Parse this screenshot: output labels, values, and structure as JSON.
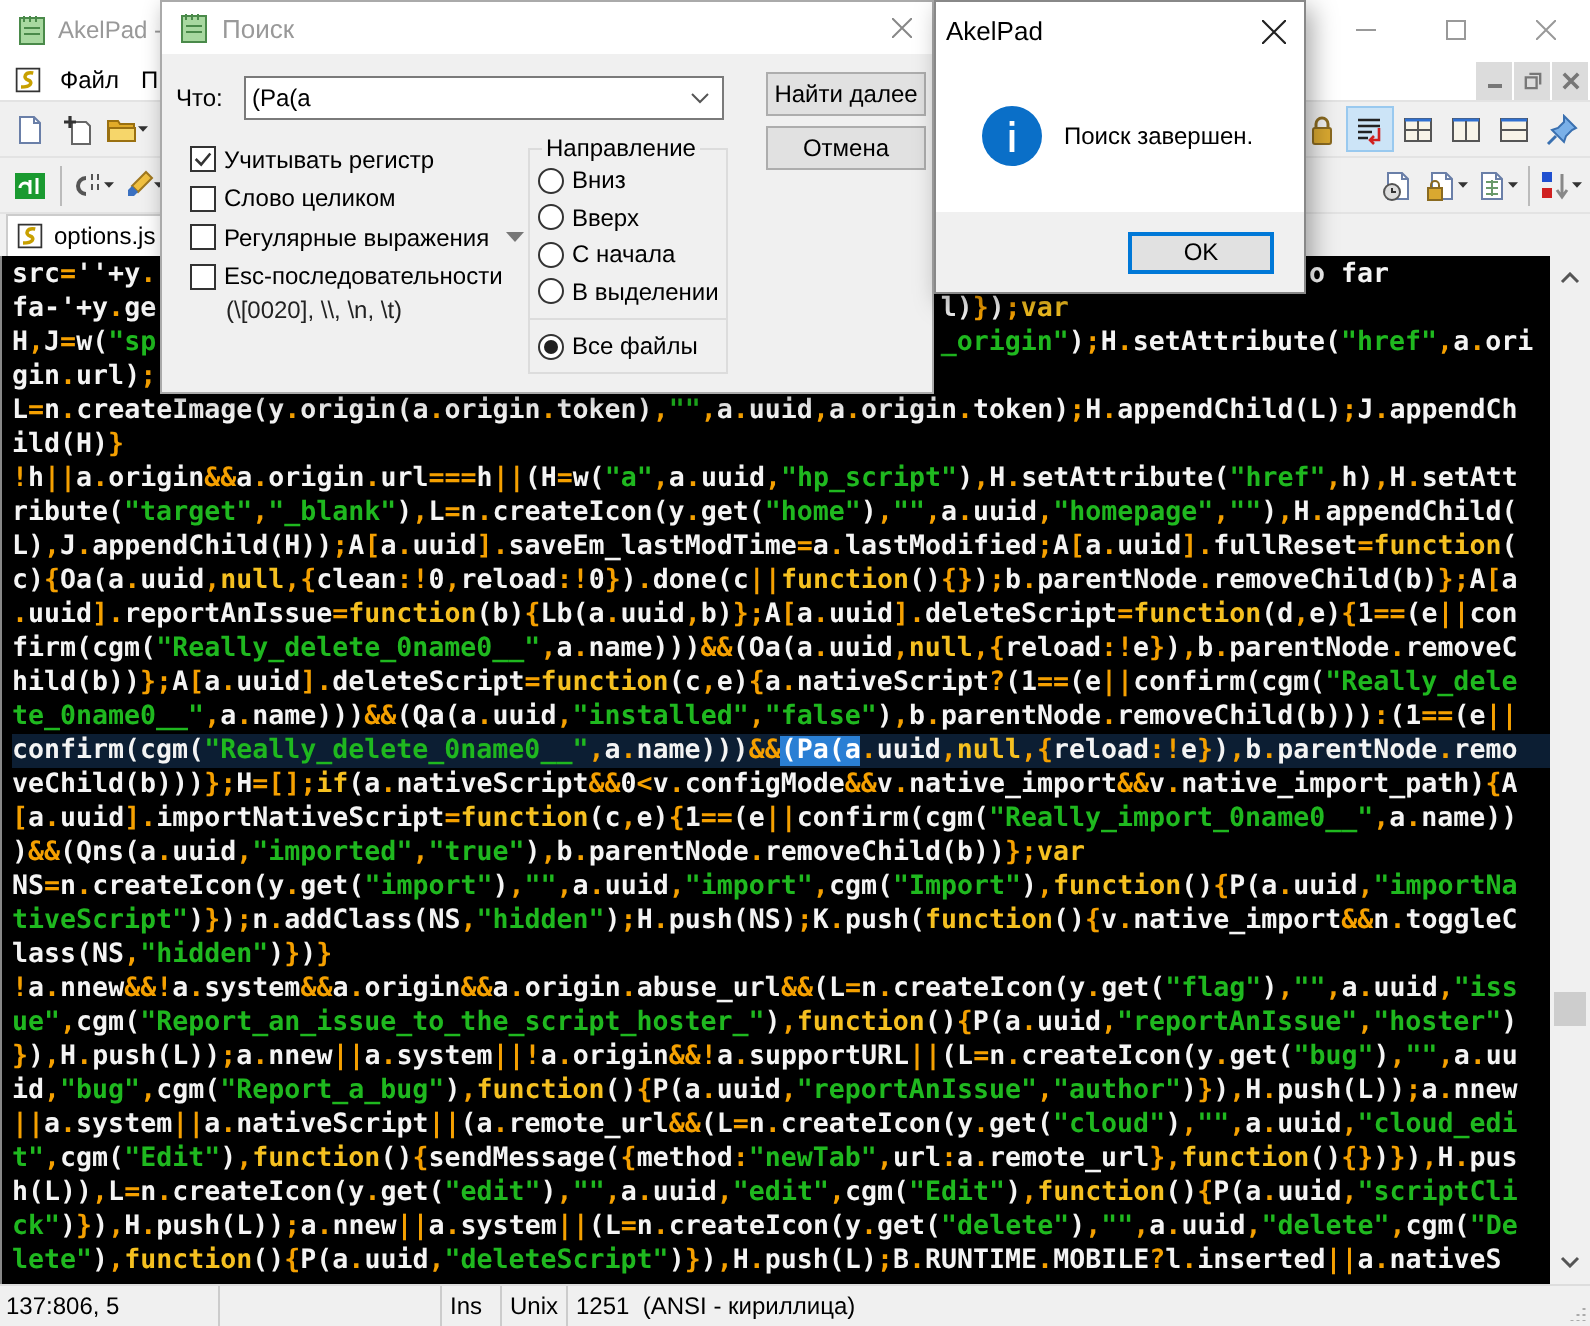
{
  "main_window": {
    "title": "AkelPad -",
    "menu": [
      "Файл",
      "П"
    ],
    "tab": {
      "label": "options.js",
      "selected": true
    }
  },
  "toolbars": [
    {
      "left": [
        {
          "kind": "new",
          "pressed": false,
          "menu": false
        },
        {
          "kind": "copy",
          "pressed": false,
          "menu": false
        },
        {
          "kind": "open",
          "pressed": false,
          "menu": true
        }
      ],
      "right": [
        {
          "kind": "lock",
          "pressed": false,
          "menu": false
        },
        {
          "kind": "wrap",
          "pressed": true,
          "menu": false
        },
        {
          "kind": "quad",
          "pressed": false,
          "menu": false
        },
        {
          "kind": "columns",
          "pressed": false,
          "menu": false
        },
        {
          "kind": "rows",
          "pressed": false,
          "menu": false
        },
        {
          "kind": "pin",
          "pressed": false,
          "menu": false
        }
      ]
    },
    {
      "left": [
        {
          "kind": "app",
          "pressed": false,
          "menu": false
        },
        {
          "kind": "separator"
        },
        {
          "kind": "codes",
          "pressed": false,
          "menu": true
        },
        {
          "kind": "marker",
          "pressed": false,
          "menu": true
        }
      ],
      "right": [
        {
          "kind": "history",
          "pressed": false,
          "menu": false
        },
        {
          "kind": "lockdoc",
          "pressed": false,
          "menu": true
        },
        {
          "kind": "doc",
          "pressed": false,
          "menu": true
        },
        {
          "kind": "separator"
        },
        {
          "kind": "sort",
          "pressed": false,
          "menu": true
        }
      ]
    }
  ],
  "editor": {
    "lines": [
      {
        "kind": "behind-both",
        "text": "src=''+y.",
        "right": "o far"
      },
      {
        "kind": "behind-find",
        "text": "fa-'+y.ge",
        "right": "l)});var"
      },
      {
        "kind": "behind-find",
        "text": "H,J=w(\"sp",
        "right": "_origin\");H.setAttribute(\"href\",a.ori"
      },
      {
        "kind": "behind-find",
        "text": "gin.url);"
      },
      {
        "text": "L=n.createImage(y.origin(a.origin.token),\"\",a.uuid,a.origin.token);H.appendChild(L);J.appendCh"
      },
      {
        "text": "ild(H)}"
      },
      {
        "text": "!h||a.origin&&a.origin.url===h||(H=w(\"a\",a.uuid,\"hp_script\"),H.setAttribute(\"href\",h),H.setAtt"
      },
      {
        "text": "ribute(\"target\",\"_blank\"),L=n.createIcon(y.get(\"home\"),\"\",a.uuid,\"homepage\",\"\"),H.appendChild("
      },
      {
        "text": "L),J.appendChild(H));A[a.uuid].saveEm_lastModTime=a.lastModified;A[a.uuid].fullReset=function("
      },
      {
        "text": "c){Oa(a.uuid,null,{clean:!0,reload:!0}).done(c||function(){});b.parentNode.removeChild(b)};A[a"
      },
      {
        "text": ".uuid].reportAnIssue=function(b){Lb(a.uuid,b)};A[a.uuid].deleteScript=function(d,e){1==(e||con"
      },
      {
        "text": "firm(cgm(\"Really_delete_0name0__\",a.name)))&&(Oa(a.uuid,null,{reload:!e}),b.parentNode.removeC"
      },
      {
        "text": "hild(b))};A[a.uuid].deleteScript=function(c,e){a.nativeScript?(1==(e||confirm(cgm(\"Really_dele"
      },
      {
        "text": "te_0name0__\",a.name)))&&(Qa(a.uuid,\"installed\",\"false\"),b.parentNode.removeChild(b))):(1==(e||"
      },
      {
        "text": "confirm(cgm(\"Really_delete_0name0__\",a.name)))&&",
        "selection": "(Pa(a",
        "rest": ".uuid,null,{reload:!e}),b.parentNode.remo",
        "current": true
      },
      {
        "text": "veChild(b)))};H=[];if(a.nativeScript&&0<v.configMode&&v.native_import&&v.native_import_path){A"
      },
      {
        "text": "[a.uuid].importNativeScript=function(c,e){1==(e||confirm(cgm(\"Really_import_0name0__\",a.name))"
      },
      {
        "text": ")&&(Qns(a.uuid,\"imported\",\"true\"),b.parentNode.removeChild(b))};var"
      },
      {
        "text": "NS=n.createIcon(y.get(\"import\"),\"\",a.uuid,\"import\",cgm(\"Import\"),function(){P(a.uuid,\"importNa"
      },
      {
        "text": "tiveScript\")});n.addClass(NS,\"hidden\");H.push(NS);K.push(function(){v.native_import&&n.toggleC"
      },
      {
        "text": "lass(NS,\"hidden\")})}"
      },
      {
        "text": "!a.nnew&&!a.system&&a.origin&&a.origin.abuse_url&&(L=n.createIcon(y.get(\"flag\"),\"\",a.uuid,\"iss"
      },
      {
        "text": "ue\",cgm(\"Report_an_issue_to_the_script_hoster_\"),function(){P(a.uuid,\"reportAnIssue\",\"hoster\")"
      },
      {
        "text": "}),H.push(L));a.nnew||a.system||!a.origin&&!a.supportURL||(L=n.createIcon(y.get(\"bug\"),\"\",a.uu"
      },
      {
        "text": "id,\"bug\",cgm(\"Report_a_bug\"),function(){P(a.uuid,\"reportAnIssue\",\"author\")}),H.push(L));a.nnew"
      },
      {
        "text": "||a.system||a.nativeScript||(a.remote_url&&(L=n.createIcon(y.get(\"cloud\"),\"\",a.uuid,\"cloud_edi"
      },
      {
        "text": "t\",cgm(\"Edit\"),function(){sendMessage({method:\"newTab\",url:a.remote_url},function(){})}),H.pus"
      },
      {
        "text": "h(L)),L=n.createIcon(y.get(\"edit\"),\"\",a.uuid,\"edit\",cgm(\"Edit\"),function(){P(a.uuid,\"scriptCli"
      },
      {
        "text": "ck\")}),H.push(L));a.nnew||a.system||(L=n.createIcon(y.get(\"delete\"),\"\",a.uuid,\"delete\",cgm(\"De"
      },
      {
        "text": "lete\"),function(){P(a.uuid,\"deleteScript\")}),H.push(L);B.RUNTIME.MOBILE?l.inserted||a.nativeS"
      }
    ]
  },
  "status_bar": {
    "position": "137:806, 5",
    "mode": "Ins",
    "newline": "Unix",
    "encoding": "1251  (ANSI - кириллица)"
  },
  "find_dialog": {
    "title": "Поиск",
    "what_label": "Что:",
    "what_value": "(Pa(a",
    "options": [
      {
        "label": "Учитывать регистр",
        "checked": true,
        "menu": false
      },
      {
        "label": "Слово целиком",
        "checked": false,
        "menu": false
      },
      {
        "label": "Регулярные выражения",
        "checked": false,
        "menu": true
      },
      {
        "label": "Esc-последовательности",
        "checked": false,
        "menu": false,
        "hint": "(\\[0020], \\\\, \\n, \\t)"
      }
    ],
    "direction": {
      "title": "Направление",
      "options": [
        {
          "label": "Вниз",
          "selected": false
        },
        {
          "label": "Вверх",
          "selected": false
        },
        {
          "label": "С начала",
          "selected": false
        },
        {
          "label": "В выделении",
          "selected": false
        }
      ],
      "scope": {
        "label": "Все файлы",
        "selected": true
      }
    },
    "buttons": [
      "Найти далее",
      "Отмена"
    ]
  },
  "message_box": {
    "title": "AkelPad",
    "message": "Поиск завершен.",
    "button": "OK"
  }
}
